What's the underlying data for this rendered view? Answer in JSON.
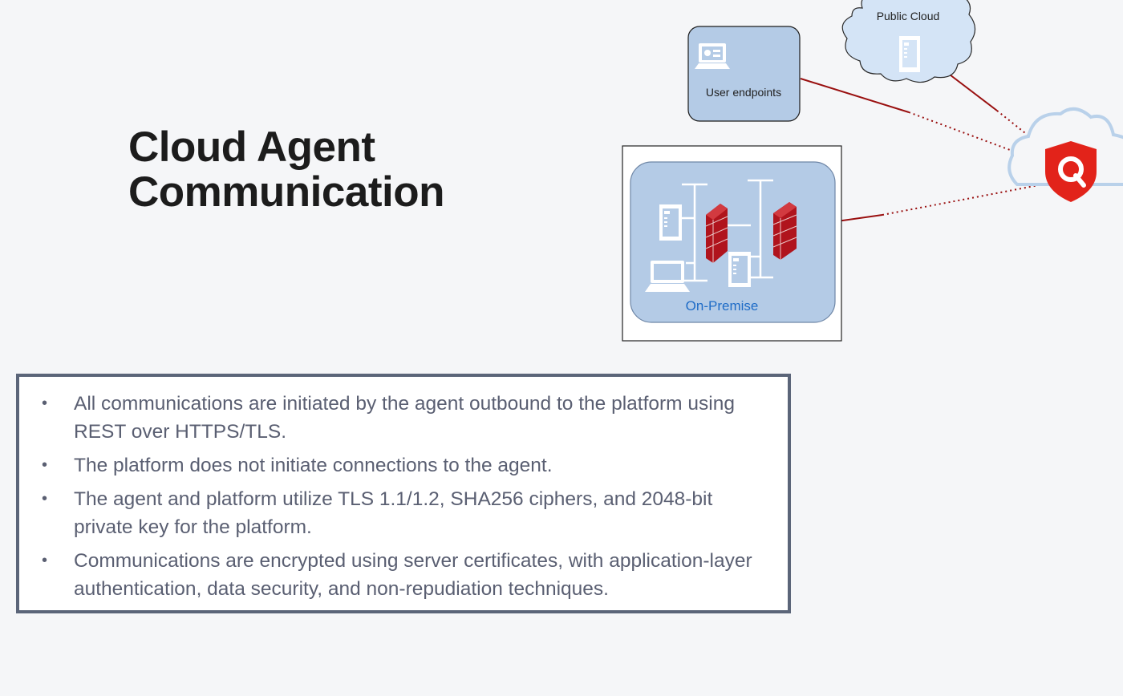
{
  "slide": {
    "title_line1": "Cloud Agent",
    "title_line2": "Communication"
  },
  "diagram": {
    "public_cloud_label": "Public Cloud",
    "user_endpoints_label": "User endpoints",
    "on_premise_label": "On-Premise",
    "colors": {
      "node_fill": "#b4cbe6",
      "cloud_fill": "#d4e4f6",
      "cloud_outline": "#b9d1ea",
      "connector": "#990f0f",
      "logo_red": "#e2231a",
      "firewall_red": "#b0141d",
      "on_premise_text": "#1f6cc7"
    }
  },
  "bullets": [
    "All communications are initiated by the agent outbound to the platform using REST over HTTPS/TLS.",
    "The platform does not initiate connections to the agent.",
    "The agent and platform utilize TLS 1.1/1.2, SHA256 ciphers, and 2048-bit private key for the platform.",
    "Communications are encrypted using server certificates, with application-layer authentication, data security, and non-repudiation techniques."
  ]
}
